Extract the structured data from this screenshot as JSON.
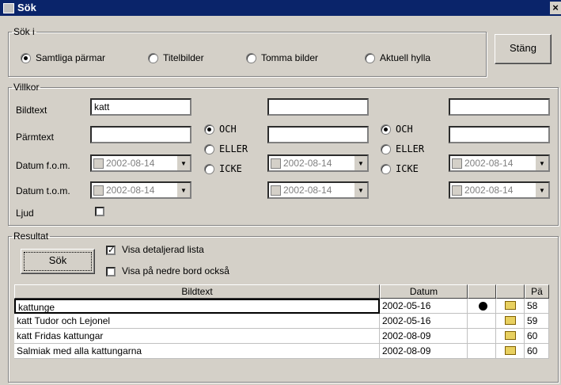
{
  "window": {
    "title": "Sök",
    "close_label": "×"
  },
  "sok_i": {
    "legend": "Sök i",
    "options": [
      {
        "label": "Samtliga pärmar",
        "selected": true
      },
      {
        "label": "Titelbilder",
        "selected": false
      },
      {
        "label": "Tomma bilder",
        "selected": false
      },
      {
        "label": "Aktuell hylla",
        "selected": false
      }
    ],
    "close_button": "Stäng"
  },
  "villkor": {
    "legend": "Villkor",
    "labels": {
      "bildtext": "Bildtext",
      "parmtext": "Pärmtext",
      "datum_fom": "Datum f.o.m.",
      "datum_tom": "Datum t.o.m.",
      "ljud": "Ljud"
    },
    "col1": {
      "bildtext": "katt",
      "parmtext": "",
      "datum_fom": "2002-08-14",
      "datum_tom": "2002-08-14"
    },
    "col2": {
      "bildtext": "",
      "parmtext": "",
      "datum_fom": "2002-08-14",
      "datum_tom": "2002-08-14"
    },
    "col3": {
      "bildtext": "",
      "parmtext": "",
      "datum_fom": "2002-08-14",
      "datum_tom": "2002-08-14"
    },
    "operators1": [
      {
        "label": "OCH",
        "selected": true
      },
      {
        "label": "ELLER",
        "selected": false
      },
      {
        "label": "ICKE",
        "selected": false
      }
    ],
    "operators2": [
      {
        "label": "OCH",
        "selected": true
      },
      {
        "label": "ELLER",
        "selected": false
      },
      {
        "label": "ICKE",
        "selected": false
      }
    ]
  },
  "resultat": {
    "legend": "Resultat",
    "search_button": "Sök",
    "visa_detaljerad": {
      "label": "Visa detaljerad lista",
      "checked": true
    },
    "visa_nedre": {
      "label": "Visa på nedre bord också",
      "checked": false
    },
    "columns": [
      "Bildtext",
      "Datum",
      "",
      "",
      "Pä"
    ],
    "rows": [
      {
        "bildtext": "kattunge",
        "datum": "2002-05-16",
        "dot": true,
        "num": "58"
      },
      {
        "bildtext": "katt Tudor och Lejonel",
        "datum": "2002-05-16",
        "dot": false,
        "num": "59"
      },
      {
        "bildtext": "katt Fridas kattungar",
        "datum": "2002-08-09",
        "dot": false,
        "num": "60"
      },
      {
        "bildtext": "Salmiak med alla kattungarna",
        "datum": "2002-08-09",
        "dot": false,
        "num": "60"
      }
    ]
  }
}
